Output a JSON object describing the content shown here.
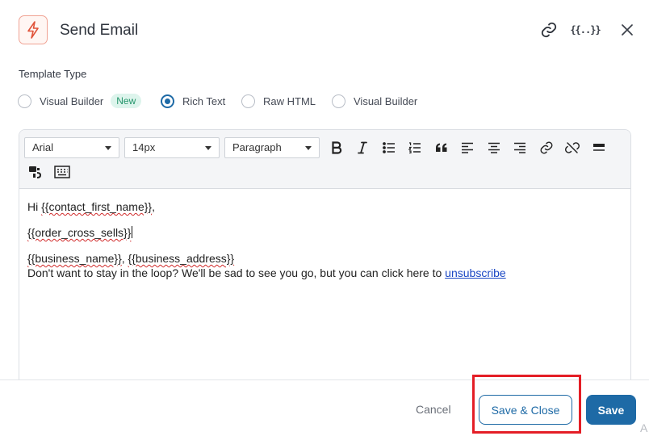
{
  "header": {
    "title": "Send Email",
    "app_icon": "lightning-bolt-icon",
    "vars_label": "{{..}}",
    "accent_color": "#e0533a"
  },
  "template_type": {
    "label": "Template Type",
    "options": [
      {
        "label": "Visual Builder",
        "badge": "New",
        "checked": false
      },
      {
        "label": "Rich Text",
        "checked": true
      },
      {
        "label": "Raw HTML",
        "checked": false
      },
      {
        "label": "Visual Builder",
        "checked": false
      }
    ]
  },
  "toolbar": {
    "font_family": "Arial",
    "font_size": "14px",
    "block_format": "Paragraph",
    "icons": [
      "bold-icon",
      "italic-icon",
      "bullet-list-icon",
      "numbered-list-icon",
      "blockquote-icon",
      "align-left-icon",
      "align-center-icon",
      "align-right-icon",
      "link-icon",
      "unlink-icon",
      "horizontal-rule-icon",
      "merge-tags-icon",
      "keyboard-icon"
    ]
  },
  "content": {
    "greeting_prefix": "Hi ",
    "contact_tag": "{{contact_first_name}}",
    "greeting_suffix": ",",
    "cross_sells_tag": "{{order_cross_sells}}",
    "business_name_tag": "{{business_name}}",
    "separator": ", ",
    "business_address_tag": "{{business_address}}",
    "unsubscribe_text": "Don't want to stay in the loop? We'll be sad to see you go, but you can click here to ",
    "unsubscribe_link": "unsubscribe"
  },
  "footer": {
    "cancel_label": "Cancel",
    "save_close_label": "Save & Close",
    "save_label": "Save",
    "primary_color": "#1e6aa6",
    "highlight_color": "#e41e26",
    "edge_glyph": "A"
  }
}
